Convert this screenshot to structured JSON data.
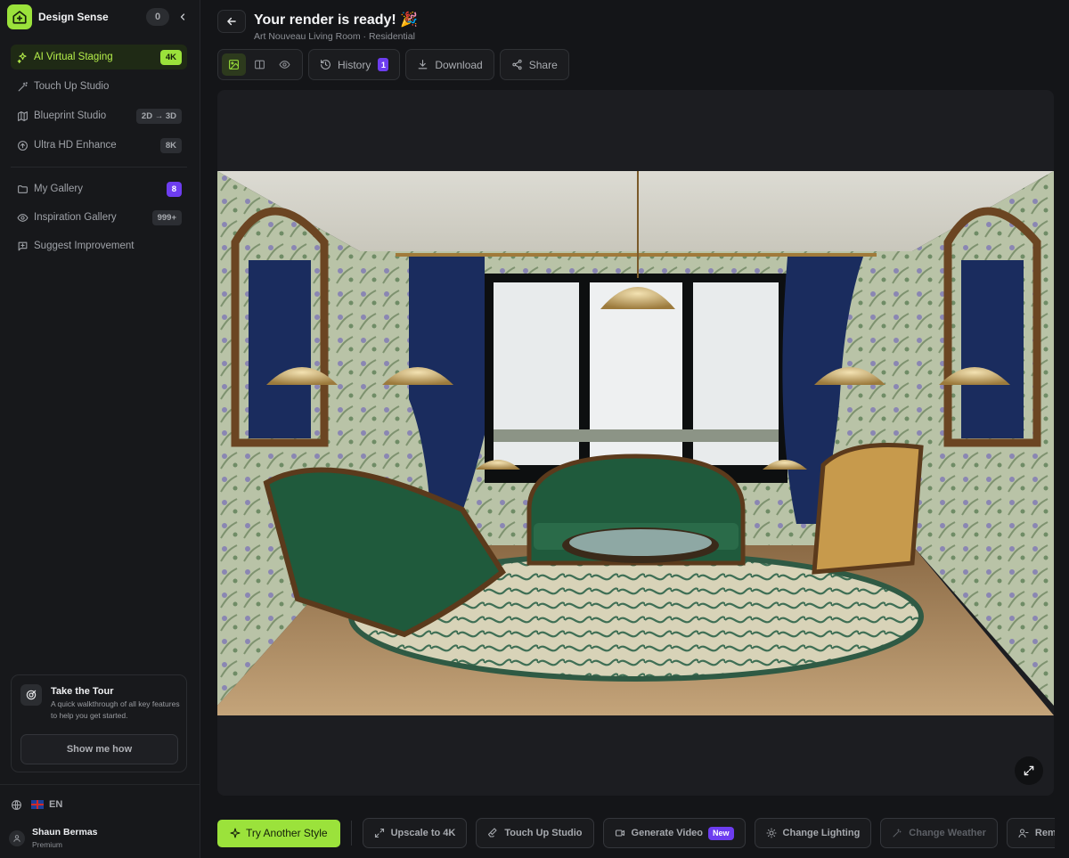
{
  "brand": {
    "name": "Design Sense",
    "credits": "0"
  },
  "nav": {
    "tools": [
      {
        "label": "AI Virtual Staging",
        "badge": "4K",
        "icon": "sparkles-icon",
        "active": true
      },
      {
        "label": "Touch Up Studio",
        "badge": "",
        "icon": "wand-icon"
      },
      {
        "label": "Blueprint Studio",
        "badge": "2D → 3D",
        "icon": "map-icon"
      },
      {
        "label": "Ultra HD Enhance",
        "badge": "8K",
        "icon": "arrow-up-circle-icon"
      }
    ],
    "library": [
      {
        "label": "My Gallery",
        "badge": "8",
        "icon": "folder-icon"
      },
      {
        "label": "Inspiration Gallery",
        "badge": "999+",
        "icon": "eye-icon"
      },
      {
        "label": "Suggest Improvement",
        "badge": "",
        "icon": "message-plus-icon"
      }
    ]
  },
  "tour": {
    "title": "Take the Tour",
    "description": "A quick walkthrough of all key features to help you get started.",
    "button": "Show me how"
  },
  "language": {
    "code": "EN"
  },
  "user": {
    "name": "Shaun Bermas",
    "plan": "Premium"
  },
  "header": {
    "title": "Your render is ready! 🎉",
    "subtitle": "Art Nouveau Living Room · Residential"
  },
  "toolbar": {
    "history_label": "History",
    "history_count": "1",
    "download_label": "Download",
    "share_label": "Share"
  },
  "actions": {
    "primary": "Try Another Style",
    "upscale": "Upscale to 4K",
    "touch_up": "Touch Up Studio",
    "generate_video": "Generate Video",
    "new_badge": "New",
    "change_lighting": "Change Lighting",
    "change_weather": "Change Weather",
    "remove": "Rem"
  },
  "colors": {
    "accent": "#9be23b",
    "badge_purple": "#6d3df0",
    "background": "#141518",
    "sidebar": "#17181b"
  }
}
